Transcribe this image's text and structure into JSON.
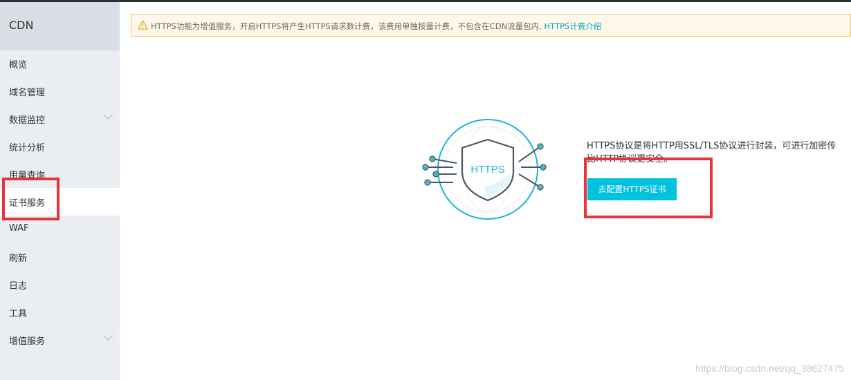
{
  "sidebar": {
    "title": "CDN",
    "items": [
      {
        "label": "概览"
      },
      {
        "label": "域名管理"
      },
      {
        "label": "数据监控"
      },
      {
        "label": "统计分析"
      },
      {
        "label": "用量查询"
      },
      {
        "label": "证书服务"
      },
      {
        "label": "WAF"
      },
      {
        "label": "刷新"
      },
      {
        "label": "日志"
      },
      {
        "label": "工具"
      },
      {
        "label": "增值服务"
      }
    ]
  },
  "alert": {
    "text": "HTTPS功能为增值服务，开启HTTPS将产生HTTPS请求数计费，该费用单独按量计费，不包含在CDN流量包内.",
    "link": "HTTPS计费介绍"
  },
  "illustration": {
    "badge_text": "HTTPS"
  },
  "content": {
    "description_line1": "HTTPS协议是将HTTP用SSL/TLS协议进行封装，可进行加密传",
    "description_line2": "比HTTP协议更安全。",
    "configure_button": "去配置HTTPS证书"
  },
  "watermark": "https://blog.csdn.net/qq_38627475",
  "colors": {
    "accent": "#00c1de",
    "link": "#00a2ca",
    "highlight": "#e8333f"
  }
}
